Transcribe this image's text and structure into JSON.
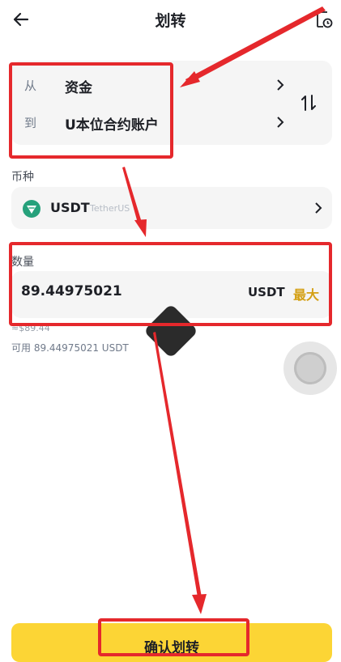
{
  "header": {
    "title": "划转"
  },
  "transfer": {
    "from_label": "从",
    "from_value": "资金",
    "to_label": "到",
    "to_value": "U本位合约账户"
  },
  "coin": {
    "section_label": "币种",
    "symbol": "USDT",
    "name": "TetherUS",
    "icon_color": "#26a17b"
  },
  "amount": {
    "section_label": "数量",
    "value": "89.44975021",
    "unit": "USDT",
    "max_label": "最大",
    "usd_value": "≈$89.44",
    "available": "可用 89.44975021 USDT"
  },
  "confirm": {
    "label": "确认划转"
  },
  "colors": {
    "accent": "#fcd535",
    "max_text": "#d4a015",
    "annotation": "#e5282c"
  }
}
